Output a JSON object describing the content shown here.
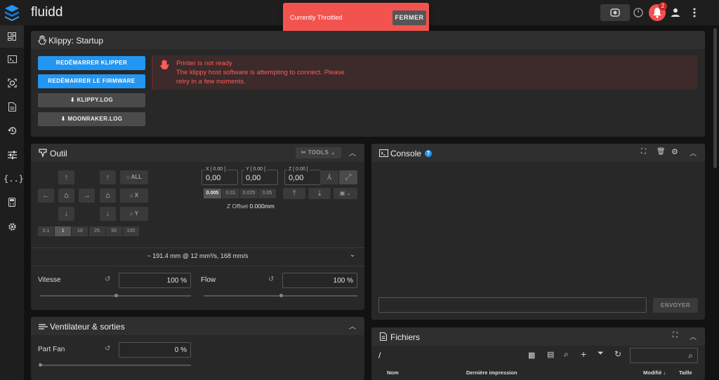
{
  "app": {
    "title": "fluidd"
  },
  "toast": {
    "message": "Currently Throttled",
    "button": "FERMER"
  },
  "header": {
    "notification_count": "2"
  },
  "colors": {
    "accent": "#2196f3",
    "alert": "#f2534f",
    "bg": "#121212",
    "card": "#282828"
  },
  "sidebar": {
    "items": [
      {
        "icon": "dashboard-icon"
      },
      {
        "icon": "console-icon"
      },
      {
        "icon": "camera-icon"
      },
      {
        "icon": "file-icon"
      },
      {
        "icon": "history-icon"
      },
      {
        "icon": "tune-icon"
      },
      {
        "icon": "code-braces-icon"
      },
      {
        "icon": "printer-icon"
      },
      {
        "icon": "gear-icon"
      }
    ]
  },
  "klippy": {
    "title": "Klippy: Startup",
    "restart_klipper": "REDÉMARRER KLIPPER",
    "restart_firmware": "REDÉMARRER LE FIRMWARE",
    "klippy_log": "KLIPPY.LOG",
    "moonraker_log": "MOONRAKER.LOG",
    "alert_line1": "Printer is not ready",
    "alert_line2": "The klippy host software is attempting to connect. Please",
    "alert_line3": "retry in a few moments."
  },
  "outil": {
    "title": "Outil",
    "tools_label": "TOOLS",
    "home_all": "ALL",
    "home_x": "X",
    "home_y": "Y",
    "steps": [
      "0.1",
      "1",
      "10",
      "25",
      "50",
      "100"
    ],
    "x_label": "X [ 0.00 ]",
    "y_label": "Y [ 0.00 ]",
    "z_label": "Z [ 0.00 ]",
    "x_val": "0,00",
    "y_val": "0,00",
    "z_val": "0,00",
    "z_steps": [
      "0.005",
      "0.01",
      "0.025",
      "0.05"
    ],
    "zoffset_label": "Z Offset",
    "zoffset_value": "0.000mm",
    "extrude_info": "~ 191.4 mm @ 12 mm³/s, 168 mm/s",
    "speed_label": "Vitesse",
    "speed_value": "100 %",
    "speed_fraction": 1.0,
    "flow_label": "Flow",
    "flow_value": "100 %",
    "flow_fraction": 1.0
  },
  "fans": {
    "title": "Ventilateur & sorties",
    "part_fan_label": "Part Fan",
    "part_fan_value": "0 %",
    "part_fan_fraction": 0.0
  },
  "console": {
    "title": "Console",
    "send_button": "ENVOYER",
    "input_value": ""
  },
  "files": {
    "title": "Fichiers",
    "path": "/",
    "search_value": "",
    "columns": [
      "Nom",
      "Dernière impression",
      "Modifié ↓",
      "Taille"
    ]
  }
}
